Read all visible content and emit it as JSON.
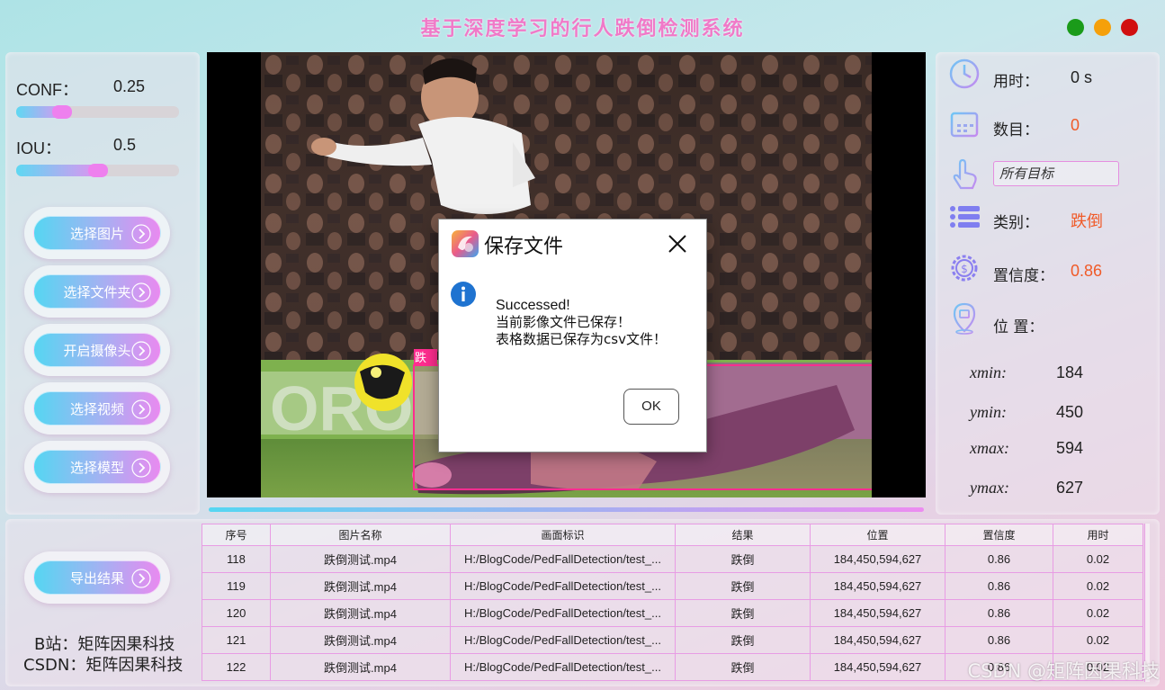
{
  "window": {
    "title": "基于深度学习的行人跌倒检测系统",
    "controls": [
      {
        "name": "minimize",
        "color": "#1a9b1a"
      },
      {
        "name": "maximize",
        "color": "#f5a00a"
      },
      {
        "name": "close",
        "color": "#d10f0f"
      }
    ]
  },
  "params": {
    "conf_label": "CONF：",
    "conf_value": "0.25",
    "conf_level": 0.25,
    "iou_label": "IOU：",
    "iou_value": "0.5",
    "iou_level": 0.5
  },
  "buttons": {
    "select_image": "选择图片",
    "select_folder": "选择文件夹",
    "open_camera": "开启摄像头",
    "select_video": "选择视频",
    "select_model": "选择模型",
    "export": "导出结果"
  },
  "credits": {
    "bilibili": "B站：矩阵因果科技",
    "csdn": "CSDN：矩阵因果科技"
  },
  "detection": {
    "label": "跌"
  },
  "stats": {
    "time_label": "用时：",
    "time_value": "0 s",
    "count_label": "数目：",
    "count_value": "0",
    "target_select": "所有目标",
    "class_label": "类别：",
    "class_value": "跌倒",
    "conf_label": "置信度：",
    "conf_value": "0.86",
    "pos_label": "位 置：",
    "value_color": "#f05a28"
  },
  "coords": {
    "xmin_label": "xmin:",
    "xmin": "184",
    "ymin_label": "ymin:",
    "ymin": "450",
    "xmax_label": "xmax:",
    "xmax": "594",
    "ymax_label": "ymax:",
    "ymax": "627"
  },
  "table": {
    "headers": [
      "序号",
      "图片名称",
      "画面标识",
      "结果",
      "位置",
      "置信度",
      "用时"
    ],
    "rows": [
      [
        "118",
        "跌倒测试.mp4",
        "H:/BlogCode/PedFallDetection/test_...",
        "跌倒",
        "184,450,594,627",
        "0.86",
        "0.02"
      ],
      [
        "119",
        "跌倒测试.mp4",
        "H:/BlogCode/PedFallDetection/test_...",
        "跌倒",
        "184,450,594,627",
        "0.86",
        "0.02"
      ],
      [
        "120",
        "跌倒测试.mp4",
        "H:/BlogCode/PedFallDetection/test_...",
        "跌倒",
        "184,450,594,627",
        "0.86",
        "0.02"
      ],
      [
        "121",
        "跌倒测试.mp4",
        "H:/BlogCode/PedFallDetection/test_...",
        "跌倒",
        "184,450,594,627",
        "0.86",
        "0.02"
      ],
      [
        "122",
        "跌倒测试.mp4",
        "H:/BlogCode/PedFallDetection/test_...",
        "跌倒",
        "184,450,594,627",
        "0.86",
        "0.02"
      ]
    ]
  },
  "watermark": "CSDN @矩阵因果科技",
  "dialog": {
    "title": "保存文件",
    "line1": "Successed!",
    "line2": "当前影像文件已保存！",
    "line3": "表格数据已保存为csv文件！",
    "ok": "OK"
  }
}
